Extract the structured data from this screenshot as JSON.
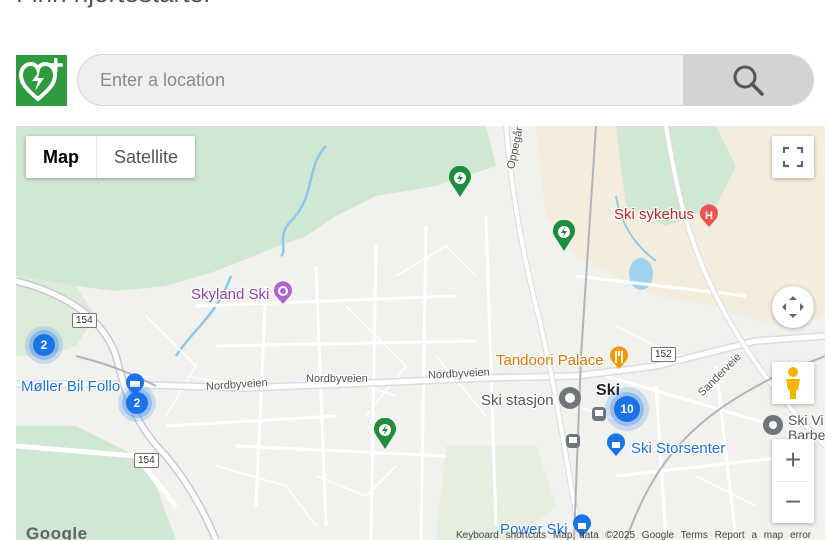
{
  "page": {
    "heading": "Finn hjertestarter"
  },
  "search": {
    "placeholder": "Enter a location",
    "value": ""
  },
  "map": {
    "type_control": {
      "map_label": "Map",
      "satellite_label": "Satellite"
    },
    "zoom": {
      "in_label": "+",
      "out_label": "−"
    },
    "places": {
      "ski_sykehus": "Ski sykehus",
      "skyland_ski": "Skyland Ski",
      "tandoori_palace": "Tandoori Palace",
      "moller_bil_follo": "Møller Bil Follo",
      "ski_stasjon": "Ski stasjon",
      "ski_town": "Ski",
      "ski_storsenter": "Ski Storsenter",
      "power_ski": "Power Ski",
      "ski_vi_1": "Ski Vi",
      "ski_vi_2": "Barbe"
    },
    "roads": {
      "nordbyveien_1": "Nordbyveien",
      "nordbyveien_2": "Nordbyveien",
      "nordbyveien_3": "Nordbyveien",
      "oppegard": "Oppegår",
      "sanderveien": "Sanderveie",
      "shield_154_a": "154",
      "shield_154_b": "154",
      "shield_152": "152"
    },
    "clusters": {
      "left": "2",
      "moller": "2",
      "ski": "10"
    },
    "google_logo": "Google",
    "attribution": "Keyboard shortcuts   Map data ©2025 Google   Terms   Report a map error"
  },
  "colors": {
    "aed_green": "#2e9b3e",
    "marker_green": "#1e8e3e",
    "cluster_blue": "#1a73e8",
    "hospital_red": "#e8554e",
    "food_orange": "#f29900",
    "shopping_blue": "#1a73e8",
    "poi_purple": "#b262d0",
    "transit_gray": "#70757a"
  },
  "icons": {
    "logo": "aed-heart-plus-icon",
    "search": "search-icon",
    "fullscreen": "fullscreen-icon",
    "rotate": "camera-control-icon",
    "pegman": "street-view-pegman-icon"
  }
}
